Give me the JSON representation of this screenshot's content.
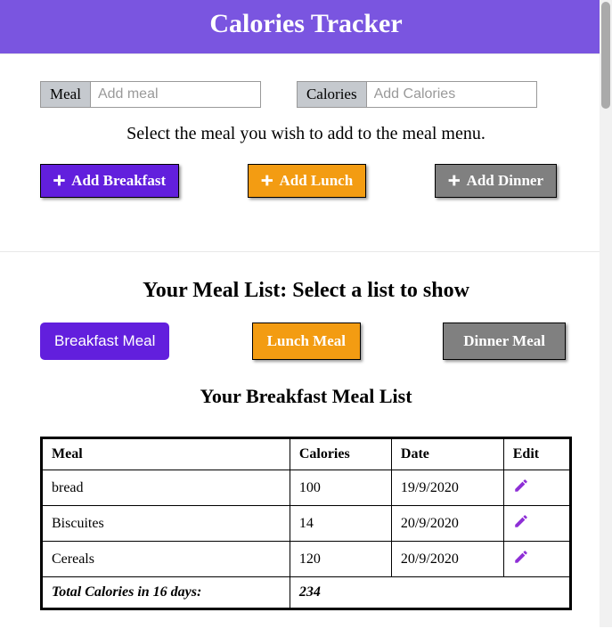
{
  "header": {
    "title": "Calories Tracker"
  },
  "inputs": {
    "meal_label": "Meal",
    "meal_placeholder": "Add meal",
    "calories_label": "Calories",
    "calories_placeholder": "Add Calories"
  },
  "instruction": "Select the meal you wish to add to the meal menu.",
  "add_buttons": {
    "breakfast": "Add Breakfast",
    "lunch": "Add Lunch",
    "dinner": "Add Dinner"
  },
  "list_select": {
    "heading": "Your Meal List: Select a list to show",
    "breakfast": "Breakfast Meal",
    "lunch": "Lunch Meal",
    "dinner": "Dinner Meal"
  },
  "current_list_heading": "Your Breakfast Meal List",
  "table": {
    "headers": {
      "meal": "Meal",
      "calories": "Calories",
      "date": "Date",
      "edit": "Edit"
    },
    "rows": [
      {
        "meal": "bread",
        "calories": "100",
        "date": "19/9/2020"
      },
      {
        "meal": "Biscuites",
        "calories": "14",
        "date": "20/9/2020"
      },
      {
        "meal": "Cereals",
        "calories": "120",
        "date": "20/9/2020"
      }
    ],
    "total_label": "Total Calories in 16 days:",
    "total_value": "234"
  }
}
